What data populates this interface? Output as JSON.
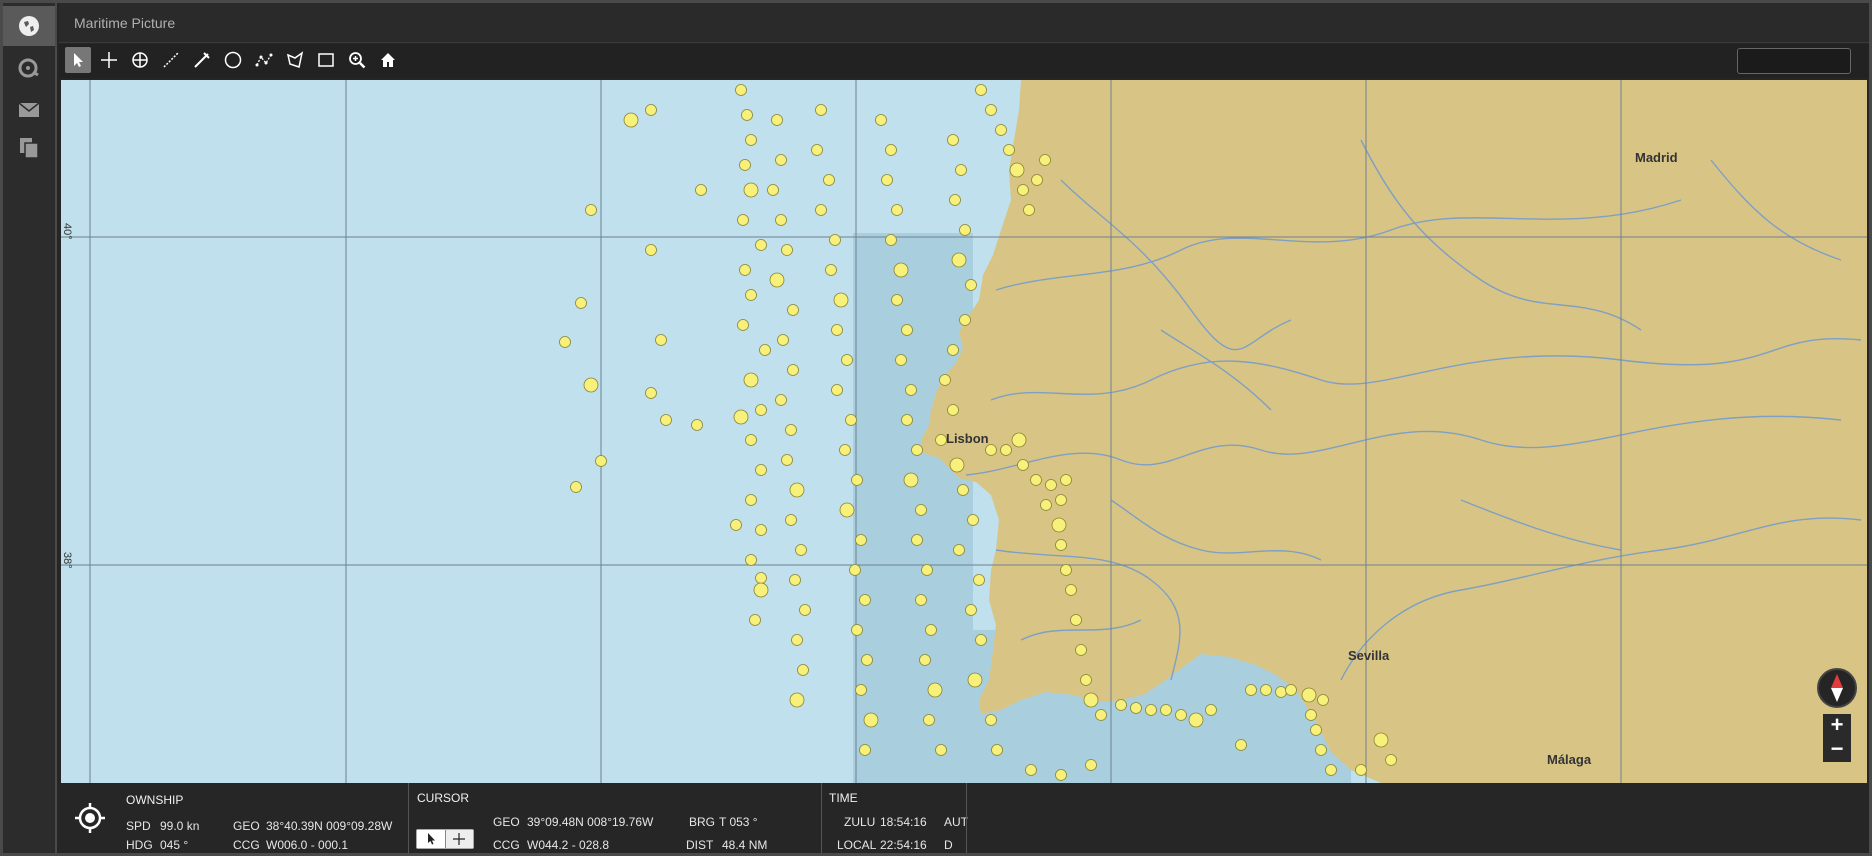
{
  "app": {
    "title": "Maritime Picture"
  },
  "sidebar": {
    "items": [
      {
        "name": "map-view",
        "icon": "globe-icon",
        "active": true
      },
      {
        "name": "tracks",
        "icon": "radar-icon",
        "active": false
      },
      {
        "name": "messages",
        "icon": "envelope-icon",
        "active": false
      },
      {
        "name": "documents",
        "icon": "documents-icon",
        "active": false
      }
    ]
  },
  "toolbar": {
    "tools": [
      {
        "name": "select",
        "icon": "pointer-icon",
        "active": true
      },
      {
        "name": "add-point",
        "icon": "crosshair-plus-icon"
      },
      {
        "name": "target",
        "icon": "target-icon"
      },
      {
        "name": "line",
        "icon": "line-icon"
      },
      {
        "name": "bearing",
        "icon": "bearing-icon"
      },
      {
        "name": "circle",
        "icon": "circle-icon"
      },
      {
        "name": "polyline",
        "icon": "polyline-icon"
      },
      {
        "name": "polygon",
        "icon": "polygon-icon"
      },
      {
        "name": "rectangle",
        "icon": "rectangle-icon"
      },
      {
        "name": "zoom",
        "icon": "zoom-in-icon"
      },
      {
        "name": "home",
        "icon": "home-icon"
      }
    ],
    "search_value": ""
  },
  "map": {
    "cities": [
      "Madrid",
      "Lisbon",
      "Sevilla",
      "Málaga"
    ],
    "lat_labels": [
      "40°",
      "38°"
    ],
    "colors": {
      "sea": "#bfe0ec",
      "land": "#d8c585",
      "river": "#7f9fc4",
      "contact": "#f7f07a"
    },
    "zoom_in": "+",
    "zoom_out": "−"
  },
  "status": {
    "ownship": {
      "title": "OWNSHIP",
      "spd_label": "SPD",
      "spd_value": "99.0 kn",
      "hdg_label": "HDG",
      "hdg_value": "045 °",
      "geo_label": "GEO",
      "geo_value": "38°40.39N 009°09.28W",
      "ccg_label": "CCG",
      "ccg_value": "W006.0 - 000.1"
    },
    "cursor": {
      "title": "CURSOR",
      "geo_label": "GEO",
      "geo_value": "39°09.48N 008°19.76W",
      "ccg_label": "CCG",
      "ccg_value": "W044.2 - 028.8",
      "brg_label": "BRG",
      "brg_value": "T  053 °",
      "dist_label": "DIST",
      "dist_value": "48.4  NM"
    },
    "time": {
      "title": "TIME",
      "zulu_label": "ZULU",
      "zulu_value": "18:54:16",
      "zulu_mode": "AUT",
      "local_label": "LOCAL",
      "local_value": "22:54:16",
      "local_mode": "D"
    }
  }
}
